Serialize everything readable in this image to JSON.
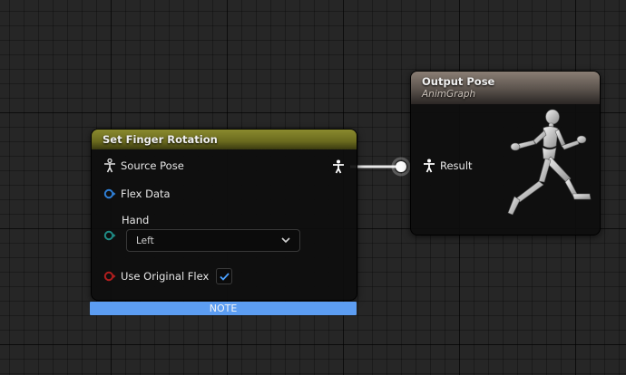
{
  "set_node": {
    "title": "Set Finger Rotation",
    "header_color": "#7a7a24",
    "pins": {
      "source_pose": "Source Pose",
      "flex_data": "Flex Data",
      "hand": "Hand",
      "use_original_flex": "Use Original Flex"
    },
    "hand_value": "Left",
    "use_original_flex_checked": true,
    "note": "NOTE"
  },
  "output_node": {
    "title": "Output Pose",
    "subtitle": "AnimGraph",
    "header_color": "#7a6e64",
    "pins": {
      "result": "Result"
    }
  },
  "colors": {
    "flex_data_pin": "#2f7fd6",
    "hand_pin": "#1f8c86",
    "use_original_flex_pin": "#b21e1e",
    "note_bar": "#5c9df2",
    "checkmark": "#4aa0ff"
  },
  "icons": {
    "pose_pin": "person-pose-icon",
    "dropdown": "chevron-down-icon",
    "checkbox": "checkmark-icon",
    "output_preview": "running-mannequin-icon"
  }
}
